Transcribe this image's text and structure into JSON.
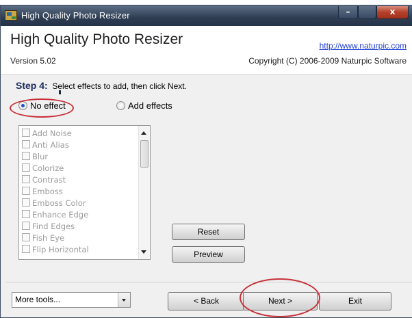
{
  "window": {
    "title": "High Quality Photo Resizer",
    "controls": {
      "minimize": "–",
      "maximize": "",
      "close": "x"
    }
  },
  "header": {
    "app_name": "High Quality Photo Resizer",
    "version": "Version 5.02",
    "url": "http://www.naturpic.com",
    "copyright": "Copyright (C) 2006-2009 Naturpic Software"
  },
  "step": {
    "label": "Step 4:",
    "instruction": "Select effects to add, then click Next."
  },
  "options": {
    "no_effect": {
      "label": "No effect",
      "selected": true
    },
    "add_effects": {
      "label": "Add effects",
      "selected": false
    }
  },
  "effects": [
    "Add Noise",
    "Anti Alias",
    "Blur",
    "Colorize",
    "Contrast",
    "Emboss",
    "Emboss Color",
    "Enhance Edge",
    "Find Edges",
    "Fish Eye",
    "Flip Horizontal"
  ],
  "buttons": {
    "reset": "Reset",
    "preview": "Preview",
    "back": "< Back",
    "next": "Next >",
    "exit": "Exit"
  },
  "more_tools": {
    "value": "More tools..."
  },
  "colors": {
    "annotation": "#c8313b",
    "link": "#1f3fd0",
    "titlebar": "#2e3d52"
  }
}
